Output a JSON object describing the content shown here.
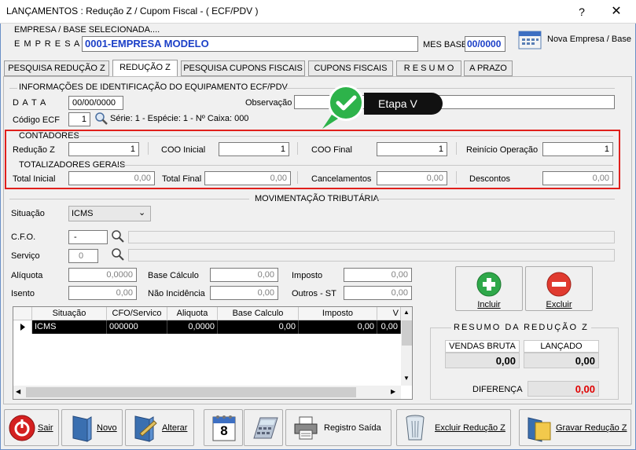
{
  "window": {
    "title": "LANÇAMENTOS : Redução Z / Cupom Fiscal - ( ECF/PDV )",
    "help_label": "?",
    "close_label": "✕"
  },
  "empresa": {
    "header_label": "EMPRESA  /  BASE  SELECIONADA....",
    "label": "E M P R E S A",
    "value": "0001-EMPRESA MODELO",
    "mes_base_label": "MES BASE",
    "mes_base_value": "00/0000",
    "nova_label": "Nova Empresa / Base"
  },
  "tabs": [
    {
      "label": "PESQUISA REDUÇÃO Z"
    },
    {
      "label": "REDUÇÃO Z"
    },
    {
      "label": "PESQUISA CUPONS FISCAIS"
    },
    {
      "label": "CUPONS FISCAIS"
    },
    {
      "label": "R E S U M O"
    },
    {
      "label": "A PRAZO"
    }
  ],
  "identificacao": {
    "header": "INFORMAÇÕES DE IDENTIFICAÇÃO DO EQUIPAMENTO ECF/PDV",
    "data_label": "D A T A",
    "data_value": "00/00/0000",
    "observacao_label": "Observação",
    "observacao_value": "",
    "codigo_label": "Código ECF",
    "codigo_value": "1",
    "info": "Série: 1  -  Espécie: 1  -  Nº Caixa: 000"
  },
  "callout": {
    "label": "Etapa V",
    "accent": "#2db34a",
    "highlight": "#e0201c"
  },
  "contadores": {
    "header": "CONTADORES",
    "reducao_label": "Redução Z",
    "reducao_value": "1",
    "coo_inicial_label": "COO  Inicial",
    "coo_inicial_value": "1",
    "coo_final_label": "COO  Final",
    "coo_final_value": "1",
    "reinicio_label": "Reinício Operação",
    "reinicio_value": "1"
  },
  "totalizadores": {
    "header": "TOTALIZADORES  GERAIS",
    "total_inicial_label": "Total Inicial",
    "total_inicial_value": "0,00",
    "total_final_label": "Total Final",
    "total_final_value": "0,00",
    "cancelamentos_label": "Cancelamentos",
    "cancelamentos_value": "0,00",
    "descontos_label": "Descontos",
    "descontos_value": "0,00"
  },
  "movimentacao": {
    "header": "MOVIMENTAÇÃO TRIBUTÁRIA",
    "situacao_label": "Situação",
    "situacao_value": "ICMS",
    "cfo_label": "C.F.O.",
    "cfo_value": "-",
    "servico_label": "Serviço",
    "servico_value": "0",
    "aliquota_label": "Alíquota",
    "aliquota_value": "0,0000",
    "base_label": "Base Cálculo",
    "base_value": "0,00",
    "imposto_label": "Imposto",
    "imposto_value": "0,00",
    "isento_label": "Isento",
    "isento_value": "0,00",
    "nao_incid_label": "Não Incidência",
    "nao_incid_value": "0,00",
    "outros_label": "Outros - ST",
    "outros_value": "0,00",
    "incluir_label": "Incluir",
    "excluir_label": "Excluir"
  },
  "grid": {
    "columns": [
      "Situação",
      "CFO/Servico",
      "Aliquota",
      "Base Calculo",
      "Imposto",
      "V"
    ],
    "rows": [
      [
        "ICMS",
        "000000",
        "0,0000",
        "0,00",
        "0,00",
        "0,00"
      ]
    ]
  },
  "resumo": {
    "header": "RESUMO  DA  REDUÇÃO Z",
    "vendas_label": "VENDAS BRUTA",
    "vendas_value": "0,00",
    "lancado_label": "LANÇADO",
    "lancado_value": "0,00",
    "diferenca_label": "DIFERENÇA",
    "diferenca_value": "0,00",
    "diferenca_color": "#e00000"
  },
  "toolbar": {
    "sair": "Sair",
    "novo": "Novo",
    "alterar": "Alterar",
    "calendar_day": "8",
    "registro": "Registro Saída",
    "excluir_reducao": "Excluir Redução Z",
    "gravar": "Gravar Redução Z"
  }
}
